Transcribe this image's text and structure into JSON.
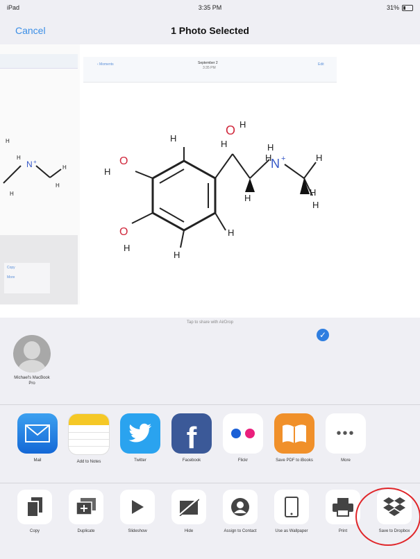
{
  "status": {
    "left": "iPad",
    "time": "3:35 PM",
    "battery": "31%"
  },
  "nav": {
    "cancel": "Cancel",
    "title": "1 Photo Selected"
  },
  "preview": {
    "thumb_menu_1": "Copy",
    "thumb_menu_2": "More",
    "mini_back": "‹ Moments",
    "mini_title": "September 2",
    "mini_sub": "3:35 PM",
    "mini_edit": "Edit",
    "atoms": {
      "h": "H",
      "o": "O",
      "n": "N",
      "plus": "+"
    }
  },
  "airdrop": {
    "hint": "Tap to share with AirDrop",
    "contact_name": "Michael's MacBook Pro"
  },
  "share_apps": [
    {
      "label": "Mail",
      "icon": "mail-icon"
    },
    {
      "label": "Add to Notes",
      "icon": "notes-icon"
    },
    {
      "label": "Twitter",
      "icon": "twitter-icon"
    },
    {
      "label": "Facebook",
      "icon": "facebook-icon"
    },
    {
      "label": "Flickr",
      "icon": "flickr-icon"
    },
    {
      "label": "Save PDF to iBooks",
      "icon": "ibooks-icon"
    },
    {
      "label": "More",
      "icon": "more-icon"
    }
  ],
  "actions": [
    {
      "label": "Copy",
      "icon": "copy-icon"
    },
    {
      "label": "Duplicate",
      "icon": "duplicate-icon"
    },
    {
      "label": "Slideshow",
      "icon": "play-icon"
    },
    {
      "label": "Hide",
      "icon": "hide-icon"
    },
    {
      "label": "Assign to Contact",
      "icon": "contact-icon"
    },
    {
      "label": "Use as Wallpaper",
      "icon": "ipad-icon"
    },
    {
      "label": "Print",
      "icon": "printer-icon"
    },
    {
      "label": "Save to Dropbox",
      "icon": "dropbox-icon"
    }
  ],
  "colors": {
    "accent": "#3a8ee6",
    "highlight_circle": "#e0262a",
    "oxygen": "#d0283c",
    "nitrogen": "#3557c7"
  }
}
